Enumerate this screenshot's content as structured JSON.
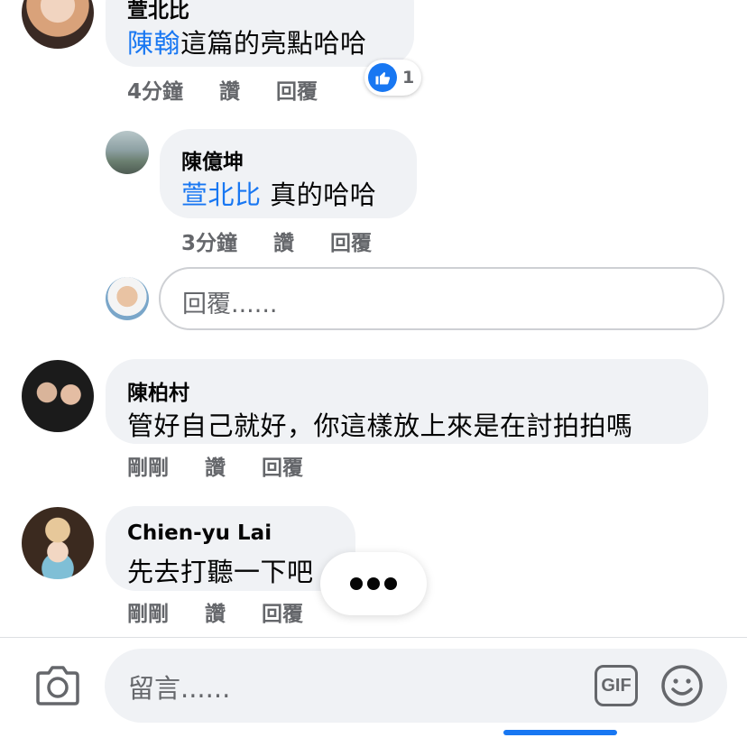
{
  "comments": [
    {
      "name": "萱北比",
      "mention": "陳翰",
      "text": "這篇的亮點哈哈",
      "time": "4分鐘",
      "like_label": "讚",
      "reply_label": "回覆",
      "reaction_count": "1"
    },
    {
      "name": "陳億坤",
      "mention": "萱北比",
      "text": " 真的哈哈",
      "time": "3分鐘",
      "like_label": "讚",
      "reply_label": "回覆"
    },
    {
      "name": "陳柏村",
      "text": "管好自己就好，你這樣放上來是在討拍拍嗎",
      "time": "剛剛",
      "like_label": "讚",
      "reply_label": "回覆"
    },
    {
      "name": "Chien-yu Lai",
      "text": "先去打聽一下吧",
      "time": "剛剛",
      "like_label": "讚",
      "reply_label": "回覆"
    }
  ],
  "reply_box": {
    "placeholder": "回覆......"
  },
  "composer": {
    "placeholder": "留言......",
    "gif_label": "GIF"
  },
  "colors": {
    "accent": "#1877f2",
    "bubble": "#f0f2f5",
    "meta": "#65676b"
  },
  "icons": [
    "camera-icon",
    "gif-icon",
    "emoji-icon",
    "like-icon",
    "typing-indicator"
  ]
}
